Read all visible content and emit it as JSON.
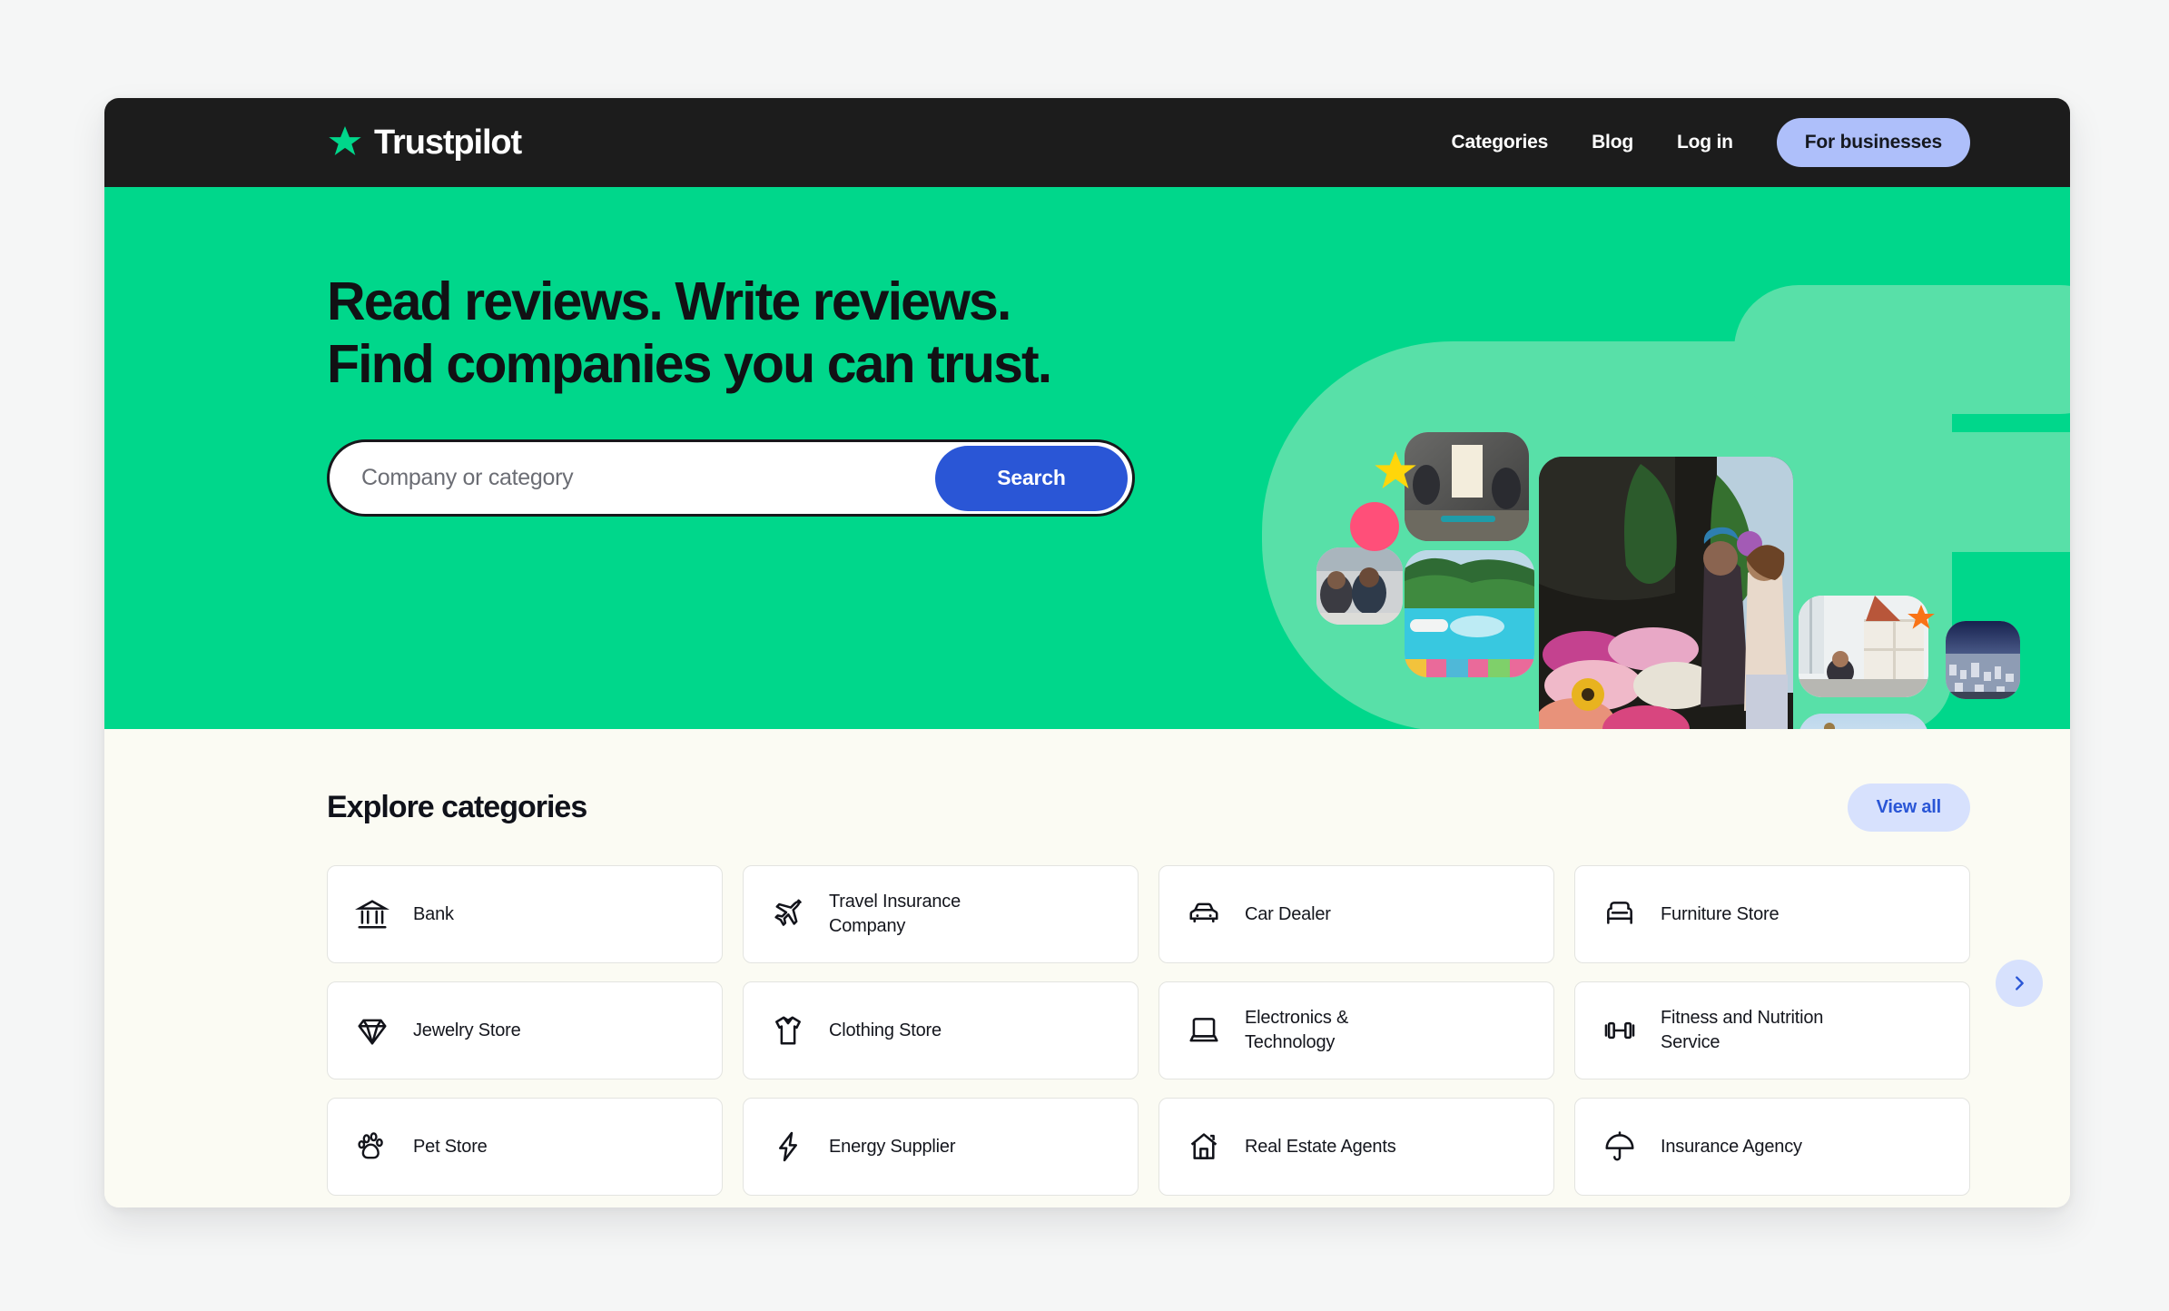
{
  "brand": {
    "name": "Trustpilot",
    "star_icon": "trustpilot-star-icon"
  },
  "nav": {
    "links": [
      {
        "label": "Categories",
        "name": "nav-link-categories"
      },
      {
        "label": "Blog",
        "name": "nav-link-blog"
      },
      {
        "label": "Log in",
        "name": "nav-link-log-in"
      }
    ],
    "cta_label": "For businesses"
  },
  "hero": {
    "title_line1": "Read reviews. Write reviews.",
    "title_line2": "Find companies you can trust.",
    "search": {
      "placeholder": "Company or category",
      "value": "",
      "button_label": "Search"
    },
    "background_color": "#00d78b",
    "decoration_color": "#58e0a8",
    "badges": [
      {
        "name": "yellow-star-badge",
        "color": "#ffd60a"
      },
      {
        "name": "pink-dot-badge",
        "color": "#ff4f79"
      },
      {
        "name": "orange-star-badge",
        "color": "#f97316"
      }
    ],
    "photos": [
      {
        "name": "photo-gym-class"
      },
      {
        "name": "photo-friends-cafe"
      },
      {
        "name": "photo-swimming-pool"
      },
      {
        "name": "photo-flower-market"
      },
      {
        "name": "photo-home-office"
      },
      {
        "name": "photo-aerial-city"
      },
      {
        "name": "photo-cactus-selfie"
      }
    ]
  },
  "categories_section": {
    "title": "Explore categories",
    "view_all_label": "View all",
    "next_label": "Next",
    "cards": [
      {
        "label": "Bank",
        "icon": "bank-icon"
      },
      {
        "label": "Travel Insurance Company",
        "icon": "airplane-icon"
      },
      {
        "label": "Car Dealer",
        "icon": "car-icon"
      },
      {
        "label": "Furniture Store",
        "icon": "armchair-icon"
      },
      {
        "label": "Jewelry Store",
        "icon": "diamond-icon"
      },
      {
        "label": "Clothing Store",
        "icon": "tshirt-icon"
      },
      {
        "label": "Electronics & Technology",
        "icon": "laptop-icon"
      },
      {
        "label": "Fitness and Nutrition Service",
        "icon": "dumbbell-icon"
      },
      {
        "label": "Pet Store",
        "icon": "paw-icon"
      },
      {
        "label": "Energy Supplier",
        "icon": "lightning-bolt-icon"
      },
      {
        "label": "Real Estate Agents",
        "icon": "house-icon"
      },
      {
        "label": "Insurance Agency",
        "icon": "umbrella-icon"
      }
    ]
  },
  "colors": {
    "page_background": "#f5f6f6",
    "nav_background": "#1c1c1c",
    "hero_green": "#00d78b",
    "section_cream": "#fbfbf3",
    "accent_blue": "#2a56d6",
    "accent_blue_soft": "#d7e1fd",
    "cta_periwinkle": "#aebffa"
  }
}
